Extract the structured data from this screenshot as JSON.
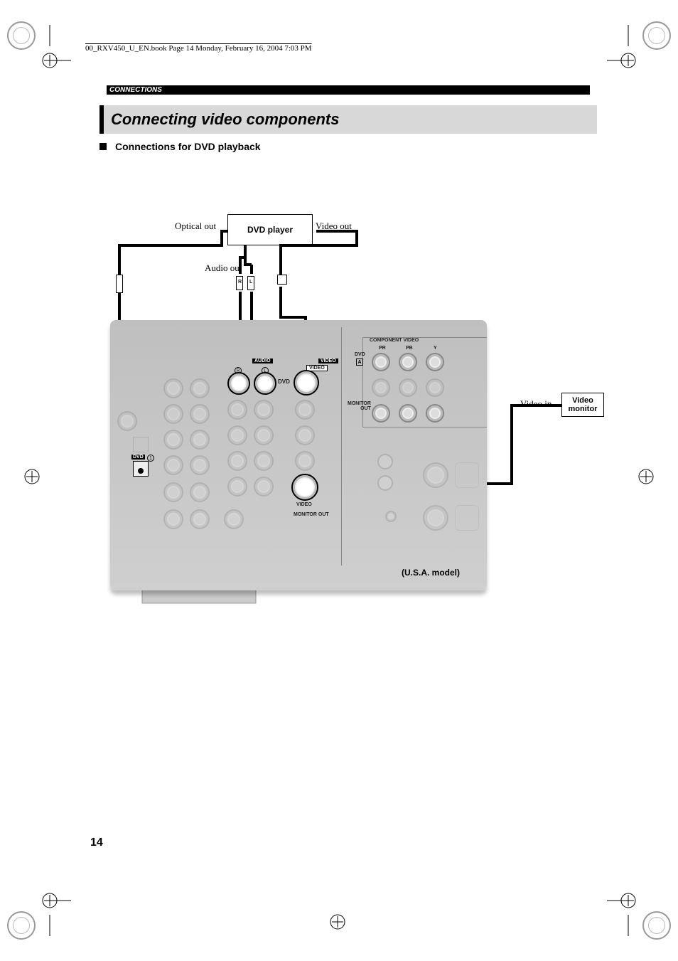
{
  "header_line": "00_RXV450_U_EN.book  Page 14  Monday, February 16, 2004  7:03 PM",
  "section_label": "CONNECTIONS",
  "title": "Connecting video components",
  "subhead": "Connections for DVD playback",
  "dvd_player_label": "DVD player",
  "video_monitor_label": "Video\nmonitor",
  "optical_out": "Optical out",
  "audio_out": "Audio out",
  "video_out": "Video out",
  "video_in": "Video in",
  "panel": {
    "audio": "AUDIO",
    "video": "VIDEO",
    "video2": "VIDEO",
    "video3": "VIDEO",
    "dvd": "DVD",
    "dvd2": "DVD",
    "dvd_circle": "1",
    "r": "R",
    "l": "L",
    "rca_r": "R",
    "rca_l": "L",
    "component_video": "COMPONENT VIDEO",
    "pr": "PR",
    "pb": "PB",
    "y": "Y",
    "dvd_a": "DVD",
    "a": "A",
    "monitor_out": "MONITOR\nOUT",
    "monitor_out2": "MONITOR OUT",
    "model": "(U.S.A. model)"
  },
  "page_number": "14"
}
